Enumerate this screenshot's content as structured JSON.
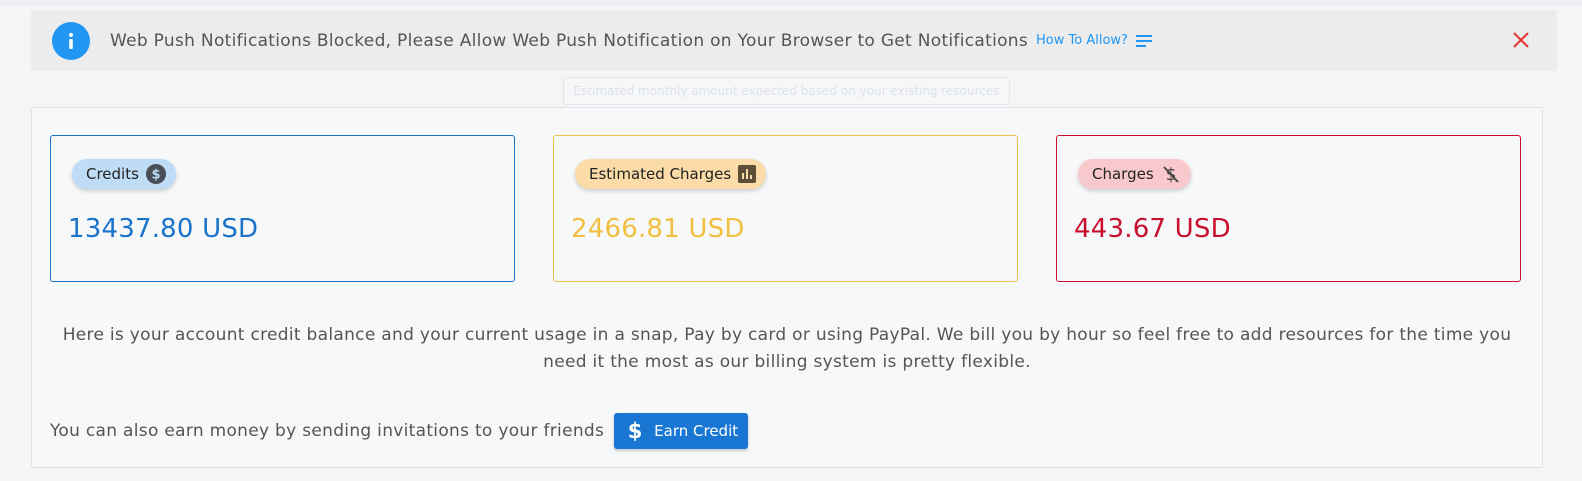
{
  "notification": {
    "message": "Web Push Notifications Blocked, Please Allow Web Push Notification on Your Browser to Get Notifications",
    "how_to_label": "How To Allow?",
    "icons": {
      "info": "info-icon",
      "menu": "menu-lines-icon",
      "close": "close-icon"
    },
    "colors": {
      "info": "#2196f3",
      "close": "#e53935"
    }
  },
  "tooltip": {
    "text": "Estimated monthly amount expected based on your existing resources"
  },
  "cards": {
    "credits": {
      "label": "Credits",
      "icon": "dollar-circle-icon",
      "amount": "13437.80 USD",
      "color": "#1a73c8"
    },
    "estimated": {
      "label": "Estimated Charges",
      "icon": "bar-chart-icon",
      "amount": "2466.81 USD",
      "color": "#f2c040"
    },
    "charges": {
      "label": "Charges",
      "icon": "money-off-icon",
      "amount": "443.67 USD",
      "color": "#c8102e"
    }
  },
  "description": "Here is your account credit balance and your current usage in a snap, Pay by card or using PayPal. We bill you by hour so feel free to add resources for the time you need it the most as our billing system is pretty flexible.",
  "earn": {
    "text": "You can also earn money by sending invitations to your friends",
    "button_label": "Earn Credit",
    "button_icon": "dollar-icon",
    "button_color": "#1976d2"
  }
}
